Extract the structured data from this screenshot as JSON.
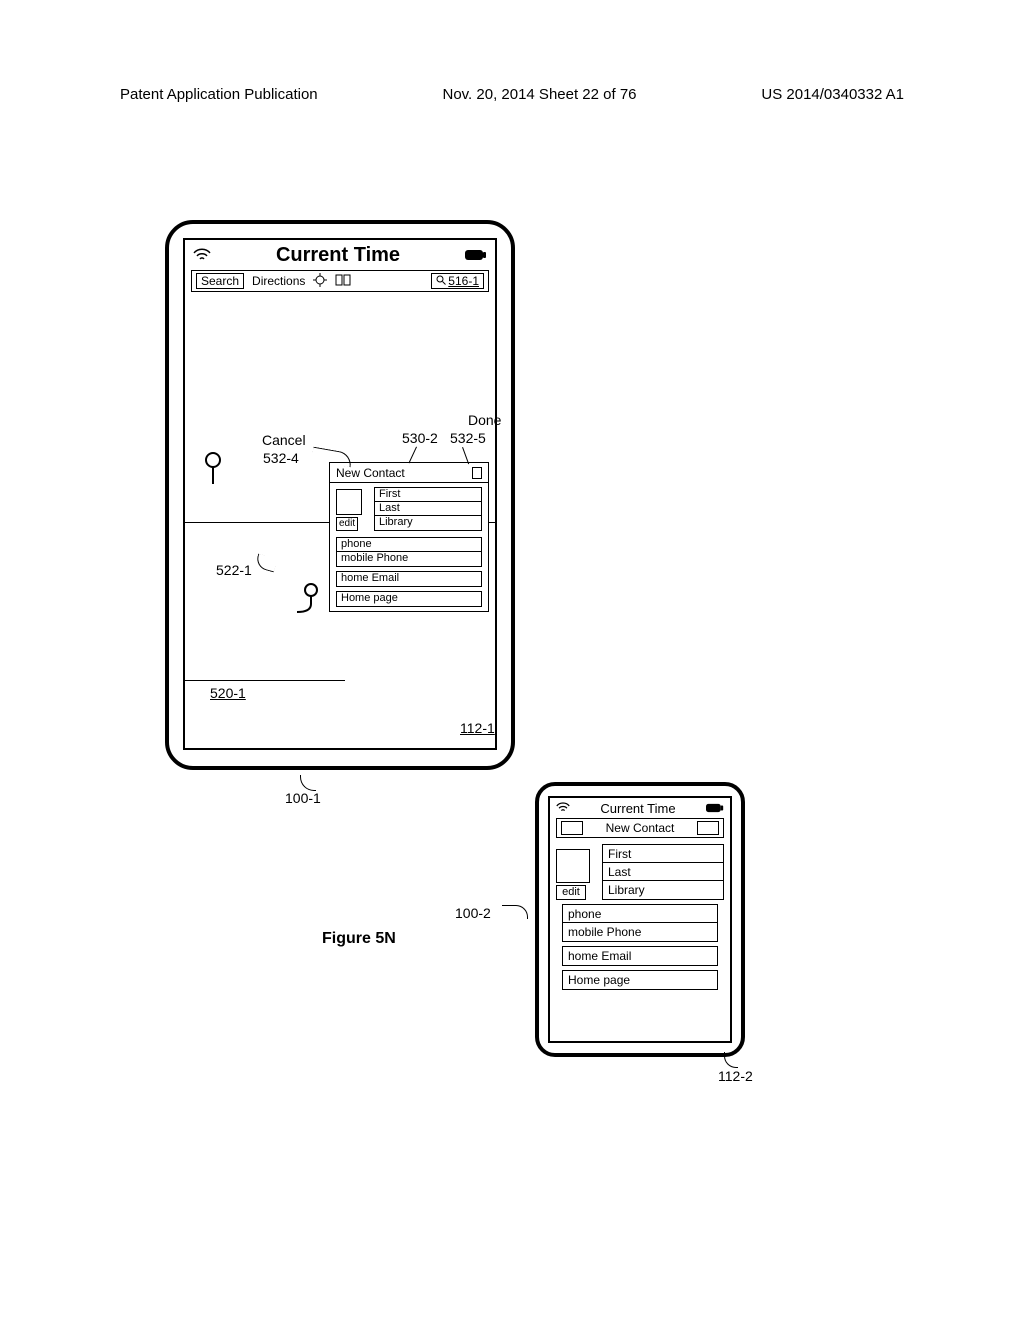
{
  "header": {
    "left": "Patent Application Publication",
    "middle": "Nov. 20, 2014  Sheet 22 of 76",
    "right": "US 2014/0340332 A1"
  },
  "figure_caption": "Figure 5N",
  "device1": {
    "ref": "100-1",
    "screen_ref": "112-1",
    "status": {
      "title": "Current Time"
    },
    "toolbar": {
      "search": "Search",
      "directions": "Directions",
      "search_field_ref": "516-1"
    },
    "map": {
      "pin_ref": "520-1",
      "route_ref": "522-1"
    },
    "overlay_labels": {
      "cancel": "Cancel",
      "cancel_ref": "532-4",
      "done": "Done",
      "done_ref": "532-5",
      "panel_ref": "530-2"
    },
    "new_contact": {
      "title": "New Contact",
      "edit": "edit",
      "first": "First",
      "last": "Last",
      "library": "Library",
      "phone": "phone",
      "mobile": "mobile Phone",
      "email": "home Email",
      "homepage": "Home page"
    }
  },
  "device2": {
    "ref": "100-2",
    "screen_ref": "112-2",
    "status_title": "Current Time",
    "new_contact": {
      "title": "New Contact",
      "edit": "edit",
      "first": "First",
      "last": "Last",
      "library": "Library",
      "phone": "phone",
      "mobile": "mobile Phone",
      "email": "home Email",
      "homepage": "Home page"
    }
  }
}
